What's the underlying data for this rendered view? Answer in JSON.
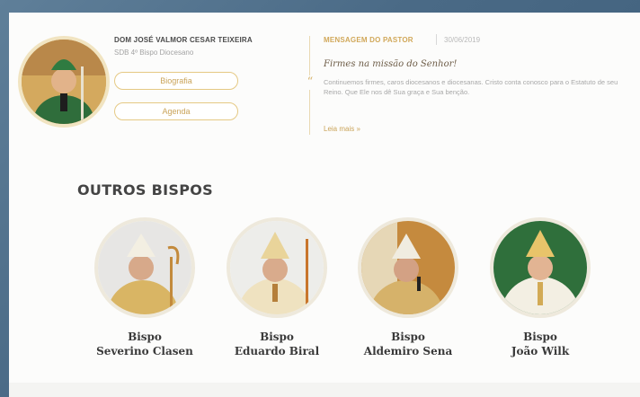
{
  "header": {
    "bishop_name": "DOM JOSÉ VALMOR CESAR TEIXEIRA",
    "bishop_subtitle": "SDB 4º Bispo Diocesano",
    "buttons": {
      "bio": "Biografia",
      "agenda": "Agenda"
    }
  },
  "message": {
    "section_label": "MENSAGEM DO PASTOR",
    "date": "30/06/2019",
    "title": "Firmes na missão do Senhor!",
    "body": "Continuemos firmes, caros diocesanos e diocesanas. Cristo conta conosco para o Estatuto de seu Reino. Que Ele nos dê Sua graça e Sua benção.",
    "read_more": "Leia mais »"
  },
  "others": {
    "title": "OUTROS BISPOS",
    "bishops": [
      {
        "line1": "Bispo",
        "line2": "Severino Clasen"
      },
      {
        "line1": "Bispo",
        "line2": "Eduardo Biral"
      },
      {
        "line1": "Bispo",
        "line2": "Aldemiro Sena"
      },
      {
        "line1": "Bispo",
        "line2": "João Wilk"
      }
    ]
  },
  "colors": {
    "accent": "#caa45a",
    "border_gold": "#e5c984",
    "bg_blue": "#4a6a86"
  }
}
